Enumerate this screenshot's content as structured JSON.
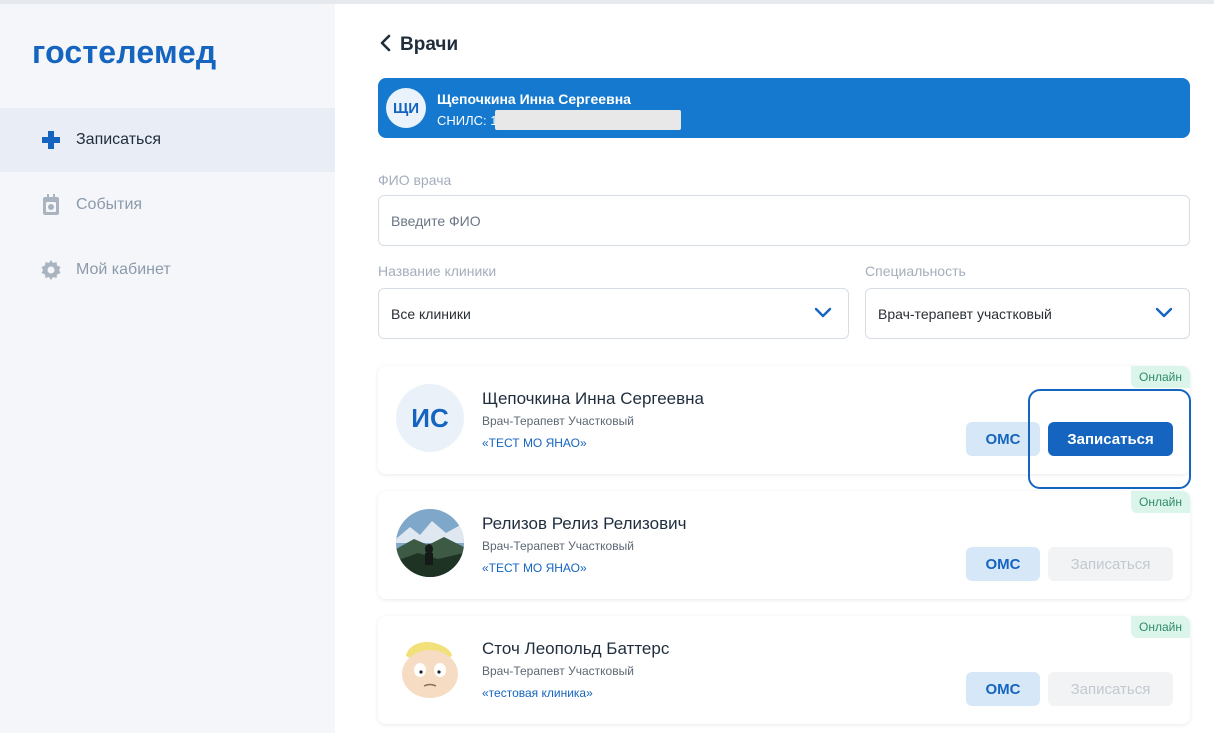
{
  "app": {
    "logo": "гостелемед"
  },
  "sidebar": {
    "items": [
      {
        "label": "Записаться",
        "icon": "medical-cross-icon",
        "active": true
      },
      {
        "label": "События",
        "icon": "calendar-icon",
        "active": false
      },
      {
        "label": "Мой кабинет",
        "icon": "gear-icon",
        "active": false
      }
    ]
  },
  "header": {
    "back_title": "Врачи"
  },
  "patient": {
    "initials": "ЩИ",
    "name": "Щепочкина Инна Сергеевна",
    "snils_label": "СНИЛС: 1"
  },
  "filters": {
    "doctor_label": "ФИО врача",
    "doctor_placeholder": "Введите ФИО",
    "clinic_label": "Название клиники",
    "clinic_value": "Все клиники",
    "specialty_label": "Специальность",
    "specialty_value": "Врач-терапевт участковый"
  },
  "doctors": [
    {
      "initials": "ИС",
      "name": "Щепочкина Инна Сергеевна",
      "specialty": "Врач-Терапевт Участковый",
      "clinic": "«ТЕСТ МО ЯНАО»",
      "status": "Онлайн",
      "payment": "ОМС",
      "book_label": "Записаться",
      "book_enabled": true
    },
    {
      "name": "Релизов Релиз Релизович",
      "specialty": "Врач-Терапевт Участковый",
      "clinic": "«ТЕСТ МО ЯНАО»",
      "status": "Онлайн",
      "payment": "ОМС",
      "book_label": "Записаться",
      "book_enabled": false
    },
    {
      "name": "Сточ Леопольд Баттерс",
      "specialty": "Врач-Терапевт Участковый",
      "clinic": "«тестовая клиника»",
      "status": "Онлайн",
      "payment": "ОМС",
      "book_label": "Записаться",
      "book_enabled": false
    }
  ],
  "colors": {
    "brand": "#1565c0",
    "patient_banner": "#1479cf",
    "online_badge_bg": "#dcf5ea",
    "oms_bg": "#d6e8f7"
  }
}
